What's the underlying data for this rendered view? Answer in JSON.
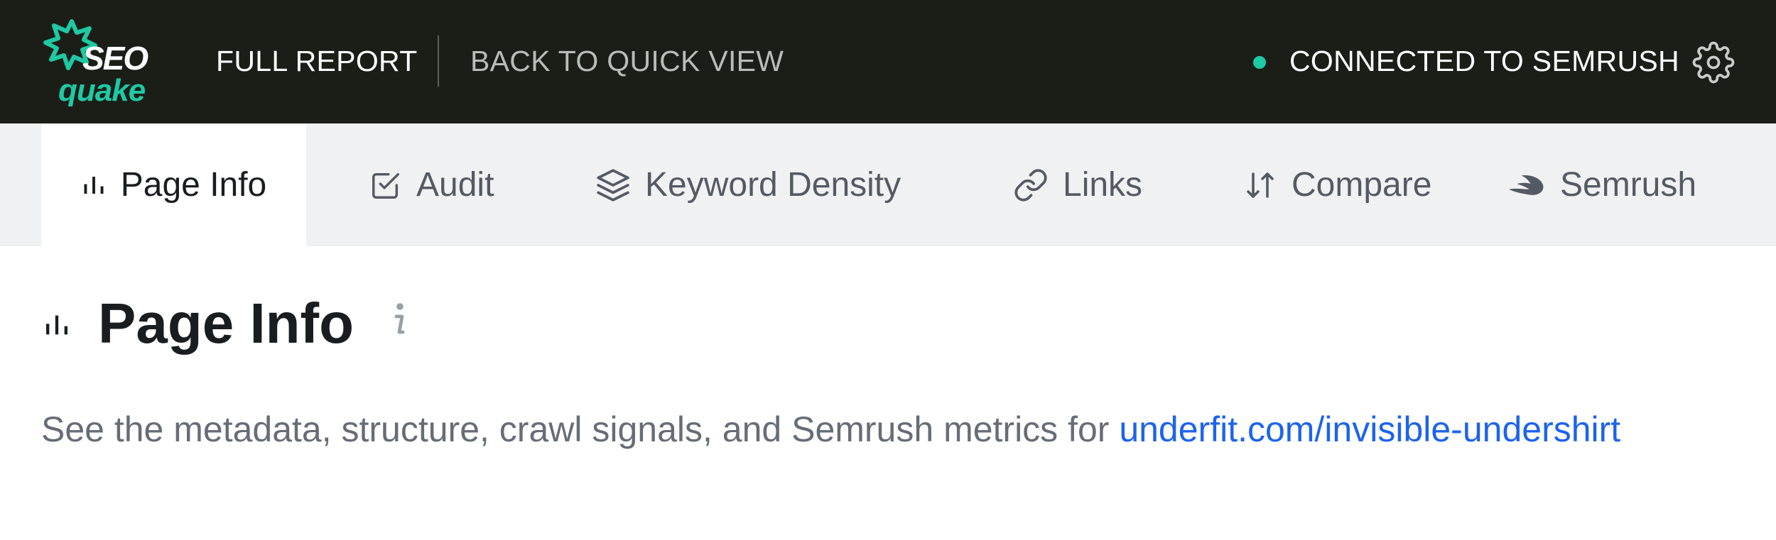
{
  "header": {
    "logo_text_top": "SEO",
    "logo_text_bottom": "quake",
    "full_report": "FULL REPORT",
    "back_to_quick_view": "BACK TO QUICK VIEW",
    "connection_status": "CONNECTED TO SEMRUSH",
    "settings_icon": "gear-icon"
  },
  "tabs": [
    {
      "label": "Page Info",
      "icon": "bar-chart-icon",
      "active": true
    },
    {
      "label": "Audit",
      "icon": "checkbox-icon",
      "active": false
    },
    {
      "label": "Keyword Density",
      "icon": "layers-icon",
      "active": false
    },
    {
      "label": "Links",
      "icon": "link-icon",
      "active": false
    },
    {
      "label": "Compare",
      "icon": "sort-arrows-icon",
      "active": false
    },
    {
      "label": "Semrush",
      "icon": "semrush-icon",
      "active": false
    }
  ],
  "main": {
    "title": "Page Info",
    "description_prefix": "See the metadata, structure, crawl signals, and Semrush metrics for ",
    "url": "underfit.com/invisible-undershirt"
  },
  "colors": {
    "header_bg": "#1a1e17",
    "brand_green": "#1ec9a4",
    "tab_bar_bg": "#f0f1f3",
    "link_blue": "#1d63ec",
    "description_gray": "#666d76"
  }
}
